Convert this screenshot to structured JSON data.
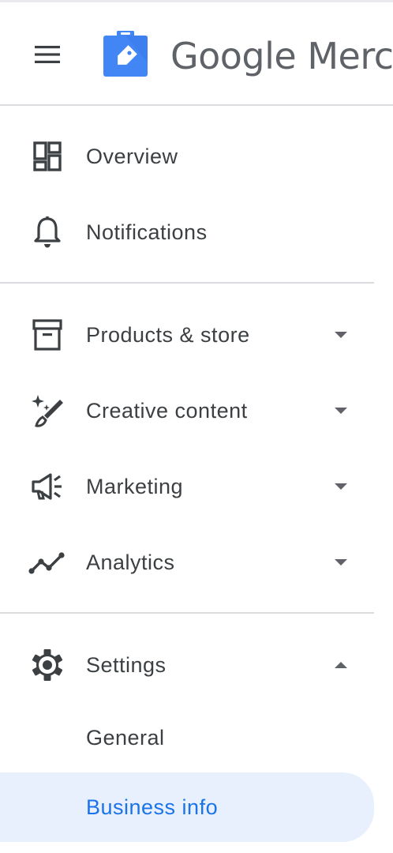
{
  "header": {
    "menu_icon": "hamburger-menu-icon",
    "logo_icon": "merchant-tag-logo-icon",
    "title": "Google Merchant Center"
  },
  "nav": {
    "overview": {
      "label": "Overview",
      "icon": "dashboard-icon"
    },
    "notifications": {
      "label": "Notifications",
      "icon": "bell-icon"
    },
    "products_store": {
      "label": "Products & store",
      "icon": "archive-box-icon",
      "expanded": false
    },
    "creative_content": {
      "label": "Creative content",
      "icon": "magic-wand-icon",
      "expanded": false
    },
    "marketing": {
      "label": "Marketing",
      "icon": "megaphone-icon",
      "expanded": false
    },
    "analytics": {
      "label": "Analytics",
      "icon": "trending-line-icon",
      "expanded": false
    },
    "settings": {
      "label": "Settings",
      "icon": "gear-icon",
      "expanded": true,
      "children": [
        {
          "label": "General",
          "active": false
        },
        {
          "label": "Business info",
          "active": true
        }
      ]
    }
  },
  "colors": {
    "active_bg": "#e8f0fe",
    "active_text": "#1a73e8",
    "text": "#3c4043",
    "icon": "#5f6368",
    "logo_blue": "#4285f4",
    "divider": "#dadce0"
  }
}
